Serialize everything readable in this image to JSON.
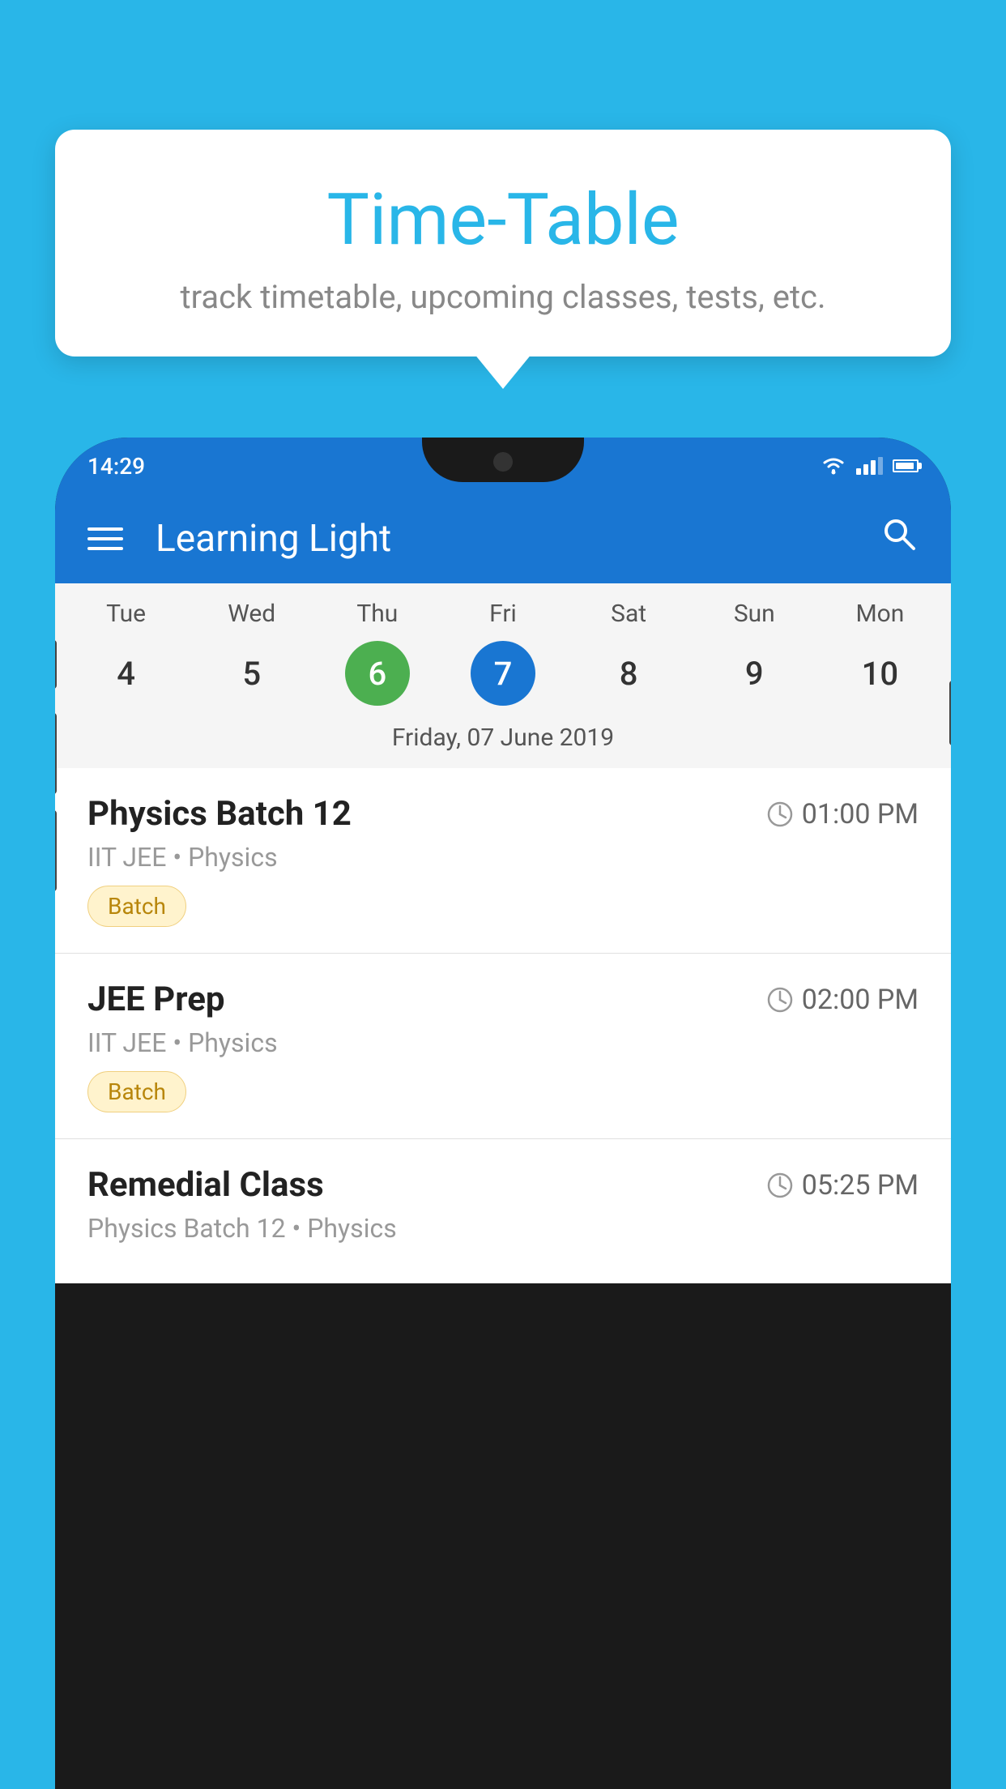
{
  "page": {
    "background_color": "#29b6e8"
  },
  "tooltip": {
    "title": "Time-Table",
    "subtitle": "track timetable, upcoming classes, tests, etc."
  },
  "phone": {
    "status_bar": {
      "time": "14:29",
      "wifi": "wifi",
      "signal": "signal",
      "battery": "battery"
    },
    "app_bar": {
      "title": "Learning Light",
      "menu_icon": "hamburger",
      "search_icon": "search"
    },
    "calendar": {
      "days": [
        "Tue",
        "Wed",
        "Thu",
        "Fri",
        "Sat",
        "Sun",
        "Mon"
      ],
      "dates": [
        "4",
        "5",
        "6",
        "7",
        "8",
        "9",
        "10"
      ],
      "today_index": 2,
      "selected_index": 3,
      "selected_date_label": "Friday, 07 June 2019"
    },
    "schedule": [
      {
        "title": "Physics Batch 12",
        "time": "01:00 PM",
        "subtitle": "IIT JEE • Physics",
        "badge": "Batch"
      },
      {
        "title": "JEE Prep",
        "time": "02:00 PM",
        "subtitle": "IIT JEE • Physics",
        "badge": "Batch"
      },
      {
        "title": "Remedial Class",
        "time": "05:25 PM",
        "subtitle": "Physics Batch 12 • Physics",
        "badge": ""
      }
    ]
  }
}
